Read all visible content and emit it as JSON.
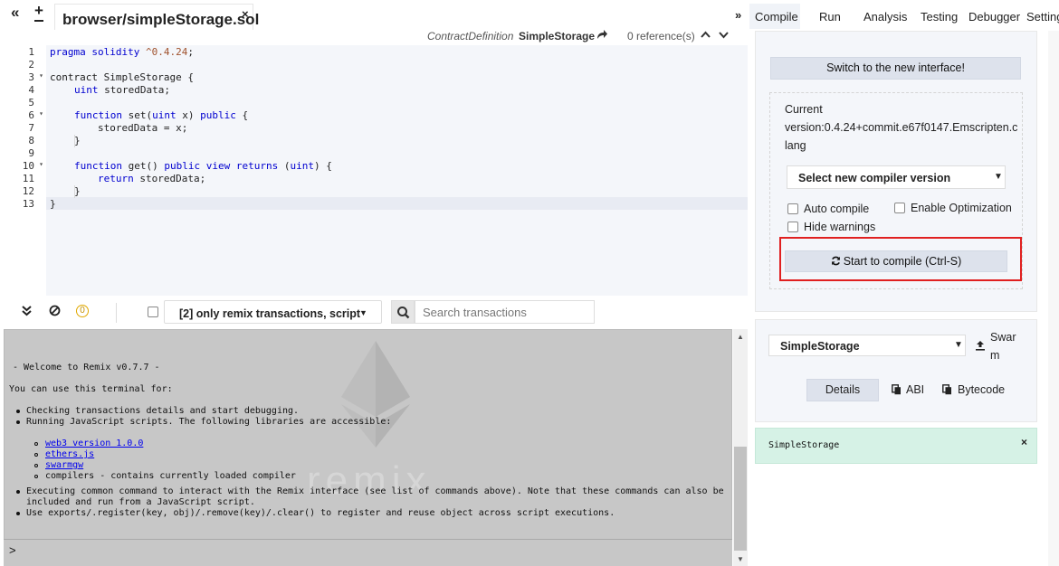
{
  "file_tabs": {
    "collapse_icon": "«",
    "new_icon": "+",
    "active_file": "browser/simpleStorage.sol",
    "close_icon": "×"
  },
  "editor": {
    "ref_bar": {
      "def_type": "ContractDefinition",
      "def_name": "SimpleStorage",
      "references": "0 reference(s)"
    },
    "line_numbers": [
      "1",
      "2",
      "3",
      "4",
      "5",
      "6",
      "7",
      "8",
      "9",
      "10",
      "11",
      "12",
      "13"
    ],
    "code": {
      "l1_a": "pragma solidity ",
      "l1_b": "^0.4.24",
      "l1_c": ";",
      "l3": "contract SimpleStorage {",
      "l4_a": "uint",
      "l4_b": " storedData;",
      "l6_a": "function",
      "l6_b": " set(",
      "l6_c": "uint",
      "l6_d": " x) ",
      "l6_e": "public",
      "l6_f": " {",
      "l7": "storedData = x;",
      "l8": "}",
      "l10_a": "function",
      "l10_b": " get() ",
      "l10_c": "public",
      "l10_d": " ",
      "l10_e": "view",
      "l10_f": " ",
      "l10_g": "returns",
      "l10_h": " (",
      "l10_i": "uint",
      "l10_j": ") {",
      "l11_a": "return",
      "l11_b": " storedData;",
      "l12": "}",
      "l13": "}"
    }
  },
  "terminal_toolbar": {
    "pending_count": "0",
    "filter_label": "[2] only remix transactions, script",
    "search_placeholder": "Search transactions"
  },
  "terminal": {
    "watermark": "remix",
    "welcome": "- Welcome to Remix v0.7.7 -",
    "intro": "You can use this terminal for:",
    "item1": "Checking transactions details and start debugging.",
    "item2": "Running JavaScript scripts. The following libraries are accessible:",
    "lib1": "web3 version 1.0.0",
    "lib2": "ethers.js",
    "lib3": "swarmgw",
    "lib4": "compilers - contains currently loaded compiler",
    "item3_l1": "Executing common command to interact with the Remix interface (see list of commands above). Note that these commands can also be",
    "item3_l2": "included and run from a JavaScript script.",
    "item4": "Use exports/.register(key, obj)/.remove(key)/.clear() to register and reuse object across script executions.",
    "prompt": ">"
  },
  "right_panel": {
    "collapse_icon": "»",
    "tabs": [
      "Compile",
      "Run",
      "Analysis",
      "Testing",
      "Debugger",
      "Settings"
    ],
    "switch_label": "Switch to the new interface!",
    "version_l1": "Current",
    "version_l2": "version:0.4.24+commit.e67f0147.Emscripten.c",
    "version_l3": "lang",
    "compiler_select": "Select new compiler version",
    "auto_compile": "Auto compile",
    "enable_optimization": "Enable Optimization",
    "hide_warnings": "Hide warnings",
    "compile_button": "Start to compile (Ctrl-S)",
    "contract_select": "SimpleStorage",
    "swarm_l1": "Swar",
    "swarm_l2": "m",
    "details": "Details",
    "abi": "ABI",
    "bytecode": "Bytecode",
    "result_name": "SimpleStorage",
    "highlight_color": "#e02020"
  }
}
